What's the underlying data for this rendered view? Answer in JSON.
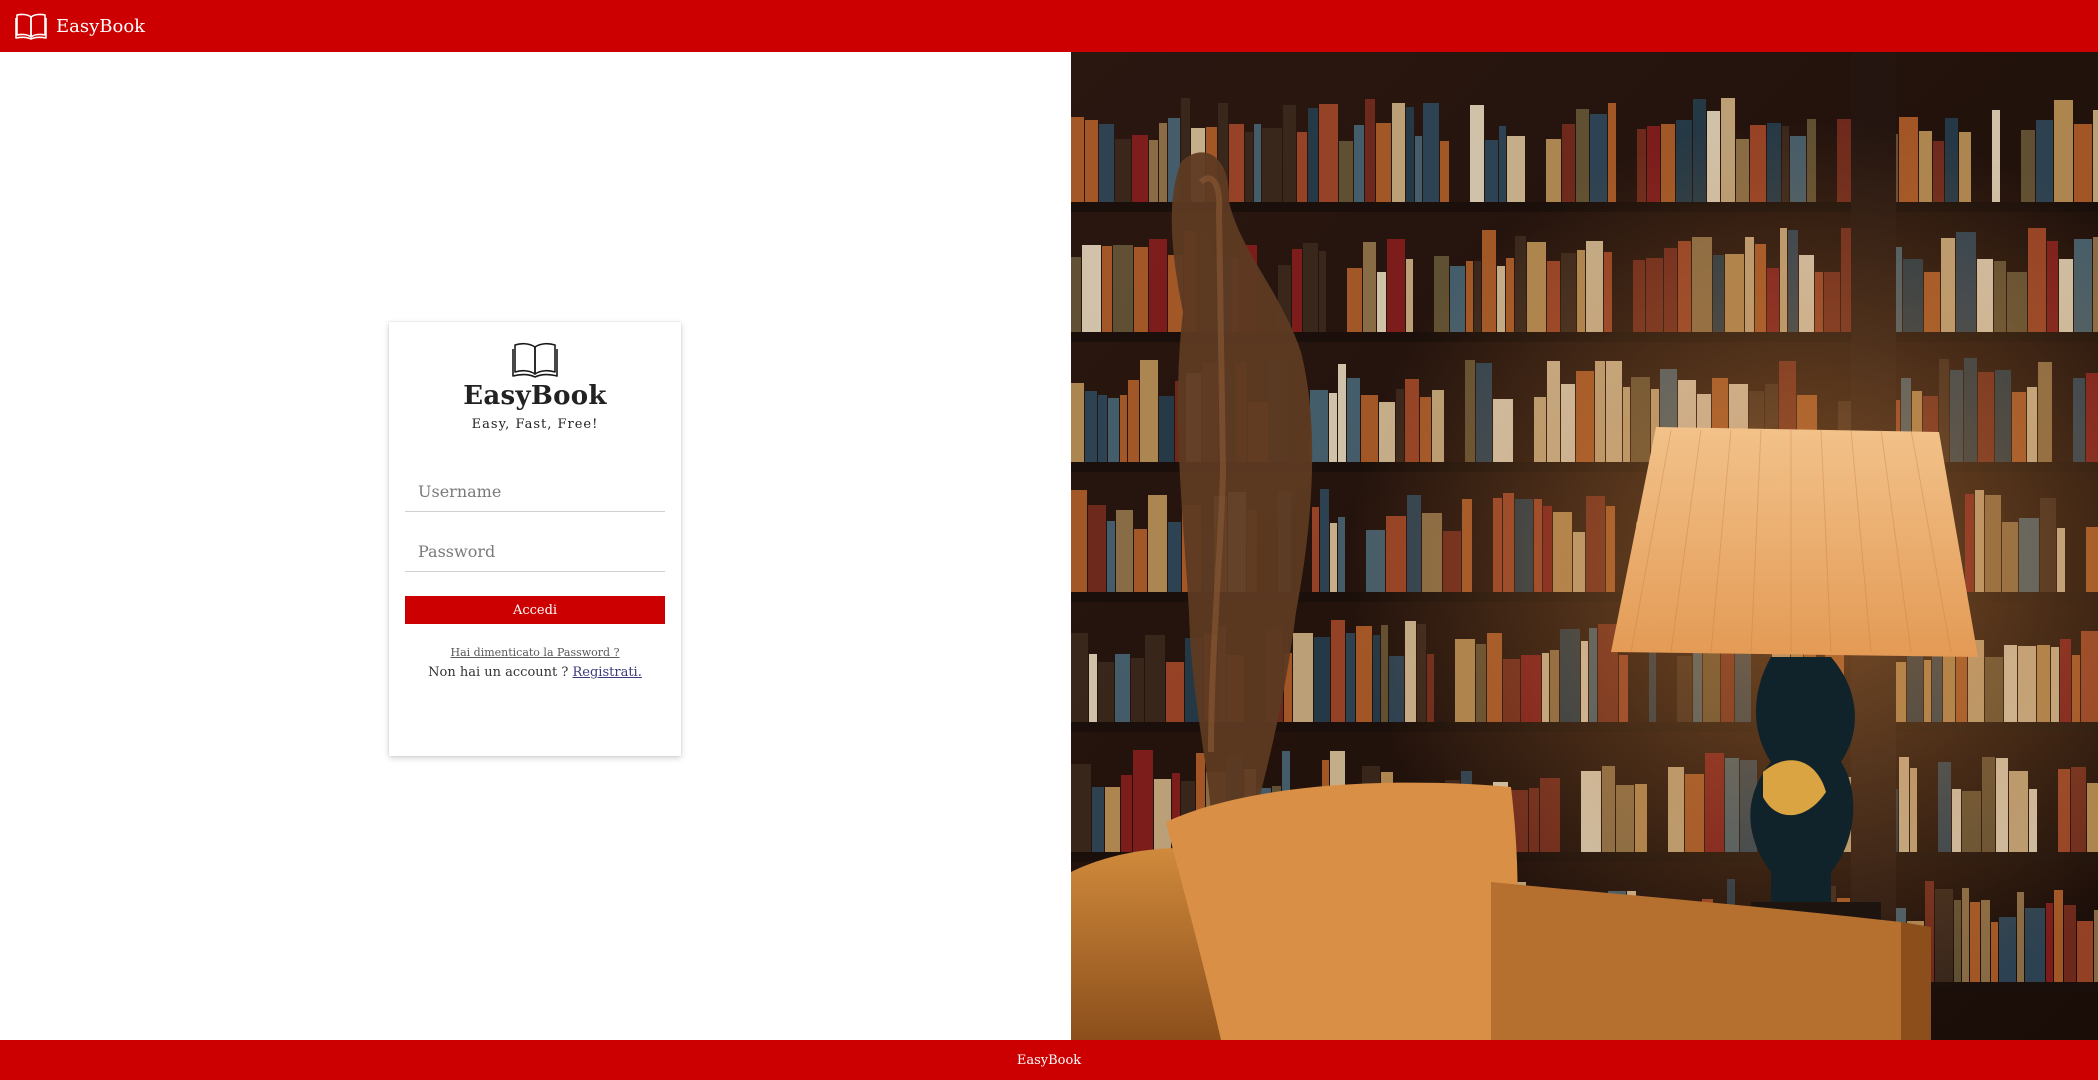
{
  "header": {
    "brand_name": "EasyBook",
    "brand_icon": "open-book-icon",
    "background": "#cc0000"
  },
  "login_card": {
    "logo_icon": "open-book-icon",
    "title": "EasyBook",
    "tagline": "Easy, Fast, Free!",
    "username": {
      "value": "",
      "placeholder": "Username"
    },
    "password": {
      "value": "",
      "placeholder": "Password"
    },
    "submit_label": "Accedi",
    "forgot_password_label": "Hai dimenticato la Password ?",
    "no_account_text": "Non hai un account ?",
    "register_label": "Registrati."
  },
  "hero_image": {
    "subject": "library-bookshelves-with-lamp-and-sofa"
  },
  "footer": {
    "label": "EasyBook"
  },
  "colors": {
    "accent": "#cc0000"
  }
}
